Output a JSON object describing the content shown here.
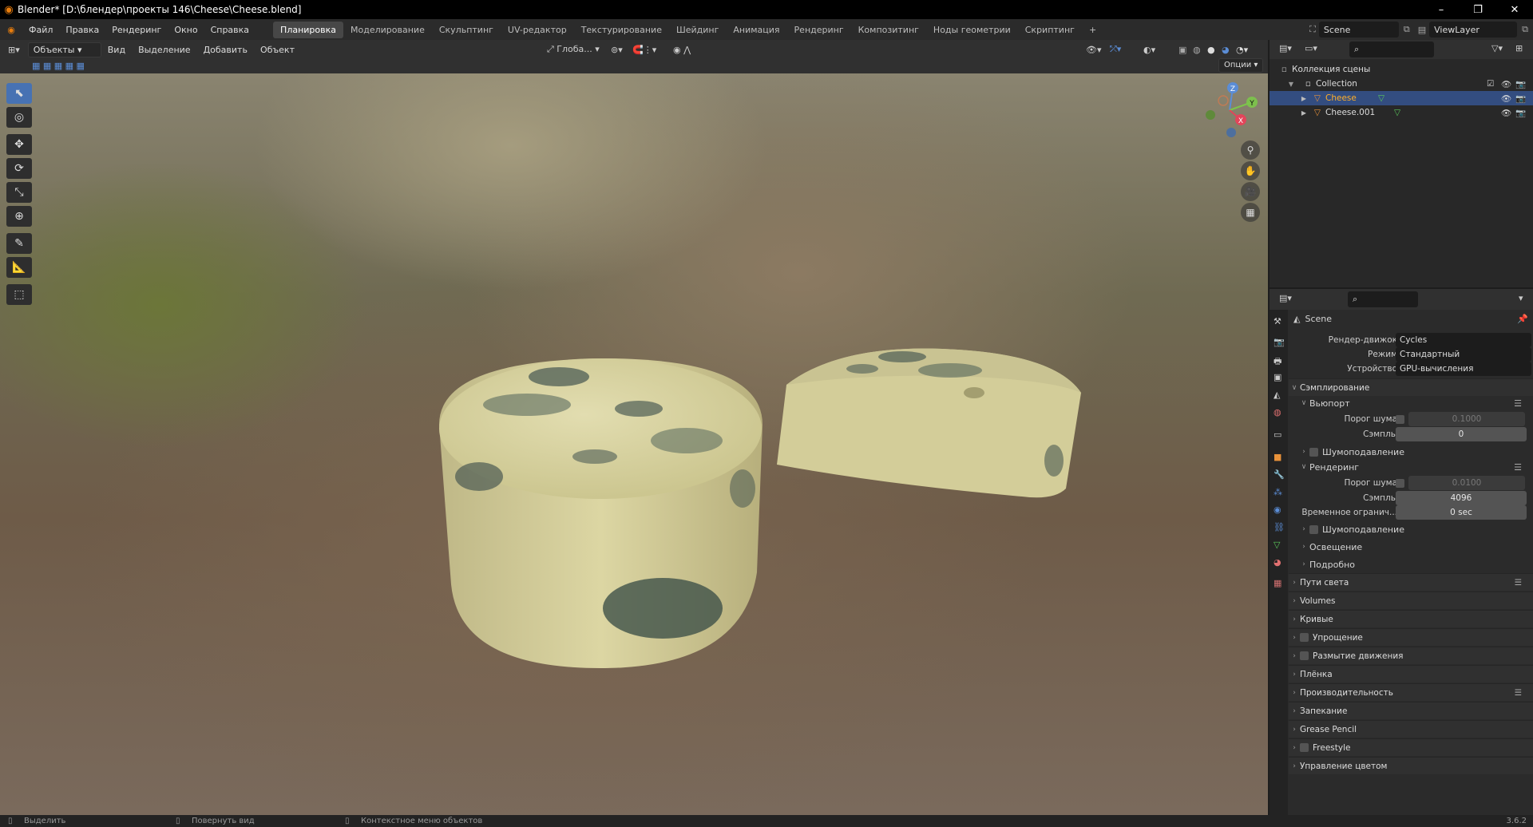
{
  "window": {
    "title": "Blender* [D:\\блендер\\проекты 146\\Cheese\\Cheese.blend]",
    "minimize": "–",
    "maximize": "❐",
    "close": "✕"
  },
  "topbar": {
    "menus": [
      "Файл",
      "Правка",
      "Рендеринг",
      "Окно",
      "Справка"
    ],
    "workspaces": [
      "Планировка",
      "Моделирование",
      "Скульптинг",
      "UV-редактор",
      "Текстурирование",
      "Шейдинг",
      "Анимация",
      "Рендеринг",
      "Композитинг",
      "Ноды геометрии",
      "Скриптинг",
      "+"
    ],
    "active_workspace": "Планировка",
    "scene": "Scene",
    "viewlayer": "ViewLayer"
  },
  "viewport_header": {
    "mode": "Объекты",
    "menus": [
      "Вид",
      "Выделение",
      "Добавить",
      "Объект"
    ],
    "transform_orientation": "Глоба...",
    "options": "Опции"
  },
  "toolbar": {
    "tools": [
      "select-box",
      "cursor",
      "move",
      "rotate",
      "scale",
      "transform",
      "annotate",
      "measure",
      "add-cube"
    ],
    "active": "select-box"
  },
  "gizmo": {
    "axes": [
      "X",
      "Y",
      "Z"
    ]
  },
  "outliner": {
    "scene_collection": "Коллекция сцены",
    "collection": "Collection",
    "objects": [
      {
        "name": "Cheese",
        "selected": true
      },
      {
        "name": "Cheese.001",
        "selected": false
      }
    ]
  },
  "properties": {
    "context": "Scene",
    "render_engine_label": "Рендер-движок",
    "render_engine": "Cycles",
    "mode_label": "Режим",
    "mode": "Стандартный",
    "device_label": "Устройство",
    "device": "GPU-вычисления",
    "sampling": "Сэмплирование",
    "viewport": "Вьюпорт",
    "noise_threshold_label": "Порог шума",
    "vp_noise": "0.1000",
    "samples_label": "Сэмплы",
    "vp_samples": "0",
    "denoise": "Шумоподавление",
    "render": "Рендеринг",
    "r_noise": "0.0100",
    "r_samples": "4096",
    "time_limit_label": "Временное огранич...",
    "time_limit": "0 sec",
    "lighting": "Освещение",
    "advanced": "Подробно",
    "sections": [
      "Пути света",
      "Volumes",
      "Кривые",
      "Упрощение",
      "Размытие движения",
      "Плёнка",
      "Производительность",
      "Запекание",
      "Grease Pencil",
      "Freestyle",
      "Управление цветом"
    ]
  },
  "statusbar": {
    "select": "Выделить",
    "rotate": "Повернуть вид",
    "context": "Контекстное меню объектов",
    "version": "3.6.2"
  },
  "colors": {
    "accent": "#4772b3",
    "cheese": "#d9d49a",
    "mold": "#3f5149"
  }
}
